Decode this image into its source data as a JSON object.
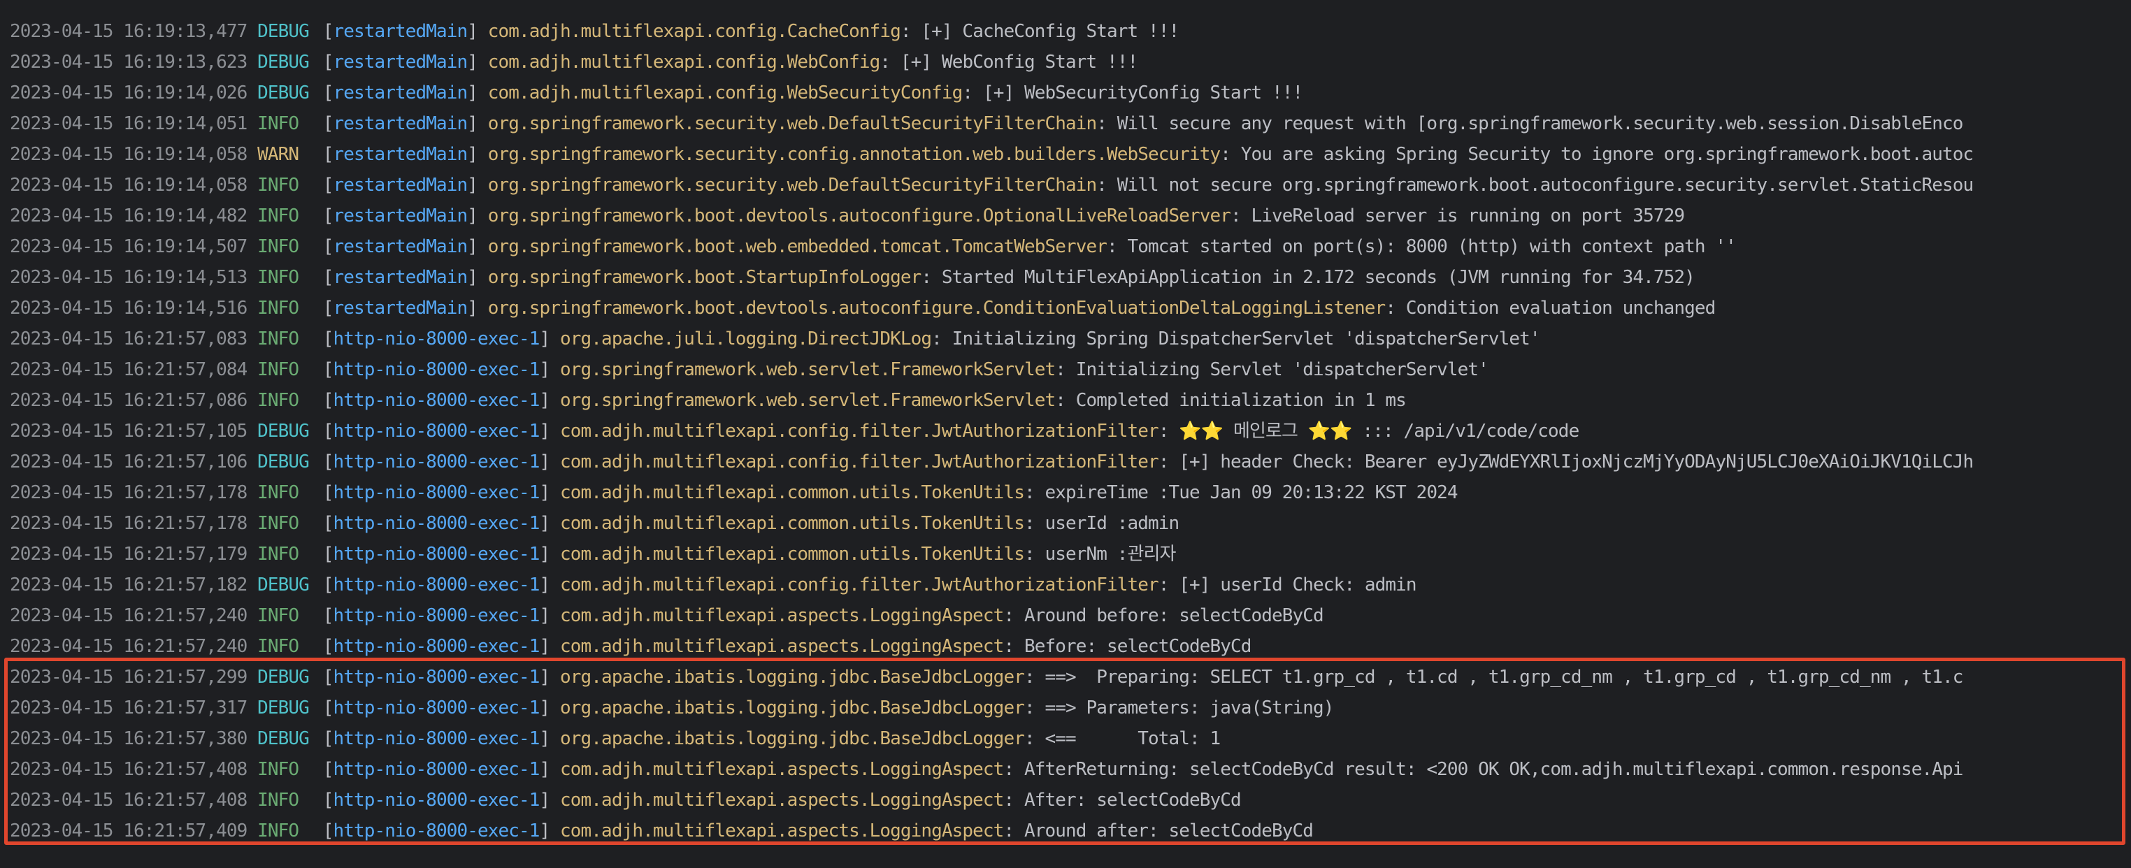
{
  "colors": {
    "background": "#1e1f22",
    "timestamp": "#8c8f94",
    "debug": "#4fc1c9",
    "info": "#6aab73",
    "warn": "#d5b778",
    "thread": "#56a8f5",
    "logger": "#d5b778",
    "message": "#bcbec4",
    "highlight": "#e0462d"
  },
  "log": {
    "lines": [
      {
        "ts": "2023-04-15 16:19:13,477",
        "level": "DEBUG",
        "thread": "restartedMain",
        "logger": "com.adjh.multiflexapi.config.CacheConfig",
        "message": "[+] CacheConfig Start !!!"
      },
      {
        "ts": "2023-04-15 16:19:13,623",
        "level": "DEBUG",
        "thread": "restartedMain",
        "logger": "com.adjh.multiflexapi.config.WebConfig",
        "message": "[+] WebConfig Start !!!"
      },
      {
        "ts": "2023-04-15 16:19:14,026",
        "level": "DEBUG",
        "thread": "restartedMain",
        "logger": "com.adjh.multiflexapi.config.WebSecurityConfig",
        "message": "[+] WebSecurityConfig Start !!!"
      },
      {
        "ts": "2023-04-15 16:19:14,051",
        "level": "INFO",
        "thread": "restartedMain",
        "logger": "org.springframework.security.web.DefaultSecurityFilterChain",
        "message": "Will secure any request with [org.springframework.security.web.session.DisableEnco"
      },
      {
        "ts": "2023-04-15 16:19:14,058",
        "level": "WARN",
        "thread": "restartedMain",
        "logger": "org.springframework.security.config.annotation.web.builders.WebSecurity",
        "message": "You are asking Spring Security to ignore org.springframework.boot.autoc"
      },
      {
        "ts": "2023-04-15 16:19:14,058",
        "level": "INFO",
        "thread": "restartedMain",
        "logger": "org.springframework.security.web.DefaultSecurityFilterChain",
        "message": "Will not secure org.springframework.boot.autoconfigure.security.servlet.StaticResou"
      },
      {
        "ts": "2023-04-15 16:19:14,482",
        "level": "INFO",
        "thread": "restartedMain",
        "logger": "org.springframework.boot.devtools.autoconfigure.OptionalLiveReloadServer",
        "message": "LiveReload server is running on port 35729"
      },
      {
        "ts": "2023-04-15 16:19:14,507",
        "level": "INFO",
        "thread": "restartedMain",
        "logger": "org.springframework.boot.web.embedded.tomcat.TomcatWebServer",
        "message": "Tomcat started on port(s): 8000 (http) with context path ''"
      },
      {
        "ts": "2023-04-15 16:19:14,513",
        "level": "INFO",
        "thread": "restartedMain",
        "logger": "org.springframework.boot.StartupInfoLogger",
        "message": "Started MultiFlexApiApplication in 2.172 seconds (JVM running for 34.752)"
      },
      {
        "ts": "2023-04-15 16:19:14,516",
        "level": "INFO",
        "thread": "restartedMain",
        "logger": "org.springframework.boot.devtools.autoconfigure.ConditionEvaluationDeltaLoggingListener",
        "message": "Condition evaluation unchanged"
      },
      {
        "ts": "2023-04-15 16:21:57,083",
        "level": "INFO",
        "thread": "http-nio-8000-exec-1",
        "logger": "org.apache.juli.logging.DirectJDKLog",
        "message": "Initializing Spring DispatcherServlet 'dispatcherServlet'"
      },
      {
        "ts": "2023-04-15 16:21:57,084",
        "level": "INFO",
        "thread": "http-nio-8000-exec-1",
        "logger": "org.springframework.web.servlet.FrameworkServlet",
        "message": "Initializing Servlet 'dispatcherServlet'"
      },
      {
        "ts": "2023-04-15 16:21:57,086",
        "level": "INFO",
        "thread": "http-nio-8000-exec-1",
        "logger": "org.springframework.web.servlet.FrameworkServlet",
        "message": "Completed initialization in 1 ms"
      },
      {
        "ts": "2023-04-15 16:21:57,105",
        "level": "DEBUG",
        "thread": "http-nio-8000-exec-1",
        "logger": "com.adjh.multiflexapi.config.filter.JwtAuthorizationFilter",
        "message": "⭐⭐ 메인로그 ⭐⭐ ::: /api/v1/code/code"
      },
      {
        "ts": "2023-04-15 16:21:57,106",
        "level": "DEBUG",
        "thread": "http-nio-8000-exec-1",
        "logger": "com.adjh.multiflexapi.config.filter.JwtAuthorizationFilter",
        "message": "[+] header Check: Bearer eyJyZWdEYXRlIjoxNjczMjYyODAyNjU5LCJ0eXAiOiJKV1QiLCJh"
      },
      {
        "ts": "2023-04-15 16:21:57,178",
        "level": "INFO",
        "thread": "http-nio-8000-exec-1",
        "logger": "com.adjh.multiflexapi.common.utils.TokenUtils",
        "message": "expireTime :Tue Jan 09 20:13:22 KST 2024"
      },
      {
        "ts": "2023-04-15 16:21:57,178",
        "level": "INFO",
        "thread": "http-nio-8000-exec-1",
        "logger": "com.adjh.multiflexapi.common.utils.TokenUtils",
        "message": "userId :admin"
      },
      {
        "ts": "2023-04-15 16:21:57,179",
        "level": "INFO",
        "thread": "http-nio-8000-exec-1",
        "logger": "com.adjh.multiflexapi.common.utils.TokenUtils",
        "message": "userNm :관리자"
      },
      {
        "ts": "2023-04-15 16:21:57,182",
        "level": "DEBUG",
        "thread": "http-nio-8000-exec-1",
        "logger": "com.adjh.multiflexapi.config.filter.JwtAuthorizationFilter",
        "message": "[+] userId Check: admin"
      },
      {
        "ts": "2023-04-15 16:21:57,240",
        "level": "INFO",
        "thread": "http-nio-8000-exec-1",
        "logger": "com.adjh.multiflexapi.aspects.LoggingAspect",
        "message": "Around before: selectCodeByCd"
      },
      {
        "ts": "2023-04-15 16:21:57,240",
        "level": "INFO",
        "thread": "http-nio-8000-exec-1",
        "logger": "com.adjh.multiflexapi.aspects.LoggingAspect",
        "message": "Before: selectCodeByCd"
      },
      {
        "ts": "2023-04-15 16:21:57,299",
        "level": "DEBUG",
        "thread": "http-nio-8000-exec-1",
        "logger": "org.apache.ibatis.logging.jdbc.BaseJdbcLogger",
        "message": "==>  Preparing: SELECT t1.grp_cd , t1.cd , t1.grp_cd_nm , t1.grp_cd , t1.grp_cd_nm , t1.c"
      },
      {
        "ts": "2023-04-15 16:21:57,317",
        "level": "DEBUG",
        "thread": "http-nio-8000-exec-1",
        "logger": "org.apache.ibatis.logging.jdbc.BaseJdbcLogger",
        "message": "==> Parameters: java(String)"
      },
      {
        "ts": "2023-04-15 16:21:57,380",
        "level": "DEBUG",
        "thread": "http-nio-8000-exec-1",
        "logger": "org.apache.ibatis.logging.jdbc.BaseJdbcLogger",
        "message": "<==      Total: 1"
      },
      {
        "ts": "2023-04-15 16:21:57,408",
        "level": "INFO",
        "thread": "http-nio-8000-exec-1",
        "logger": "com.adjh.multiflexapi.aspects.LoggingAspect",
        "message": "AfterReturning: selectCodeByCd result: <200 OK OK,com.adjh.multiflexapi.common.response.Api"
      },
      {
        "ts": "2023-04-15 16:21:57,408",
        "level": "INFO",
        "thread": "http-nio-8000-exec-1",
        "logger": "com.adjh.multiflexapi.aspects.LoggingAspect",
        "message": "After: selectCodeByCd"
      },
      {
        "ts": "2023-04-15 16:21:57,409",
        "level": "INFO",
        "thread": "http-nio-8000-exec-1",
        "logger": "com.adjh.multiflexapi.aspects.LoggingAspect",
        "message": "Around after: selectCodeByCd"
      }
    ]
  }
}
